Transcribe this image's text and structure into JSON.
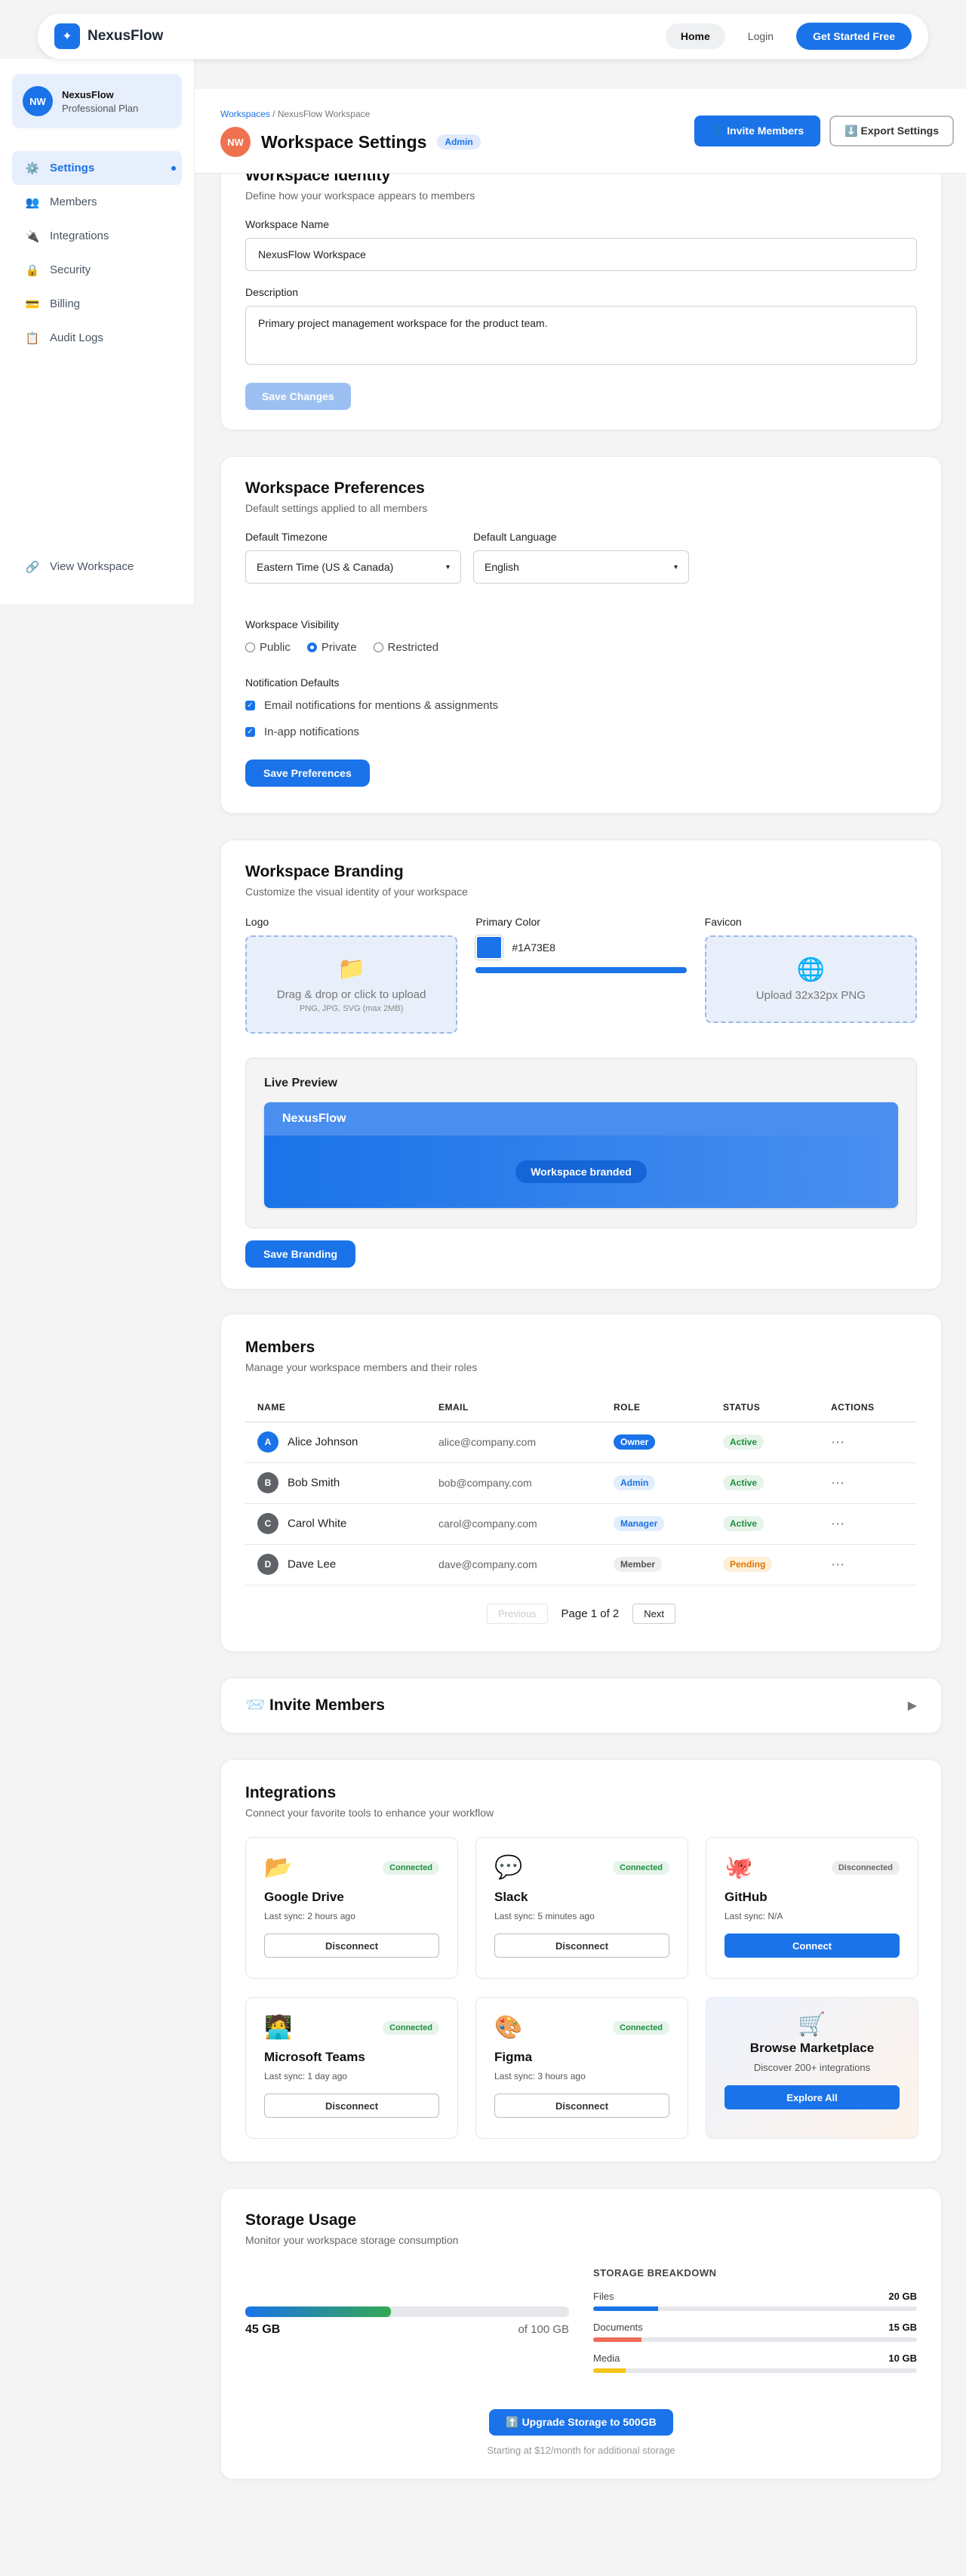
{
  "app": {
    "name": "NexusFlow",
    "logo_glyph": "✦"
  },
  "topnav": {
    "home": "Home",
    "login": "Login",
    "cta": "Get Started Free"
  },
  "sidebar": {
    "profile": {
      "initials": "NW",
      "name": "NexusFlow",
      "plan": "Professional Plan"
    },
    "items": [
      {
        "label": "Settings",
        "icon": "⚙️",
        "active": true
      },
      {
        "label": "Members",
        "icon": "👥"
      },
      {
        "label": "Integrations",
        "icon": "🔌"
      },
      {
        "label": "Security",
        "icon": "🔒"
      },
      {
        "label": "Billing",
        "icon": "💳"
      },
      {
        "label": "Audit Logs",
        "icon": "📋"
      }
    ],
    "view_workspace": {
      "label": "View Workspace",
      "icon": "🔗"
    }
  },
  "header": {
    "breadcrumb_link": "Workspaces",
    "breadcrumb_sep": " / ",
    "breadcrumb_current": "NexusFlow Workspace",
    "initials": "NW",
    "title": "Workspace Settings",
    "badge": "Admin",
    "invite_label": "👤 Invite Members",
    "export_label": "⬇️ Export Settings"
  },
  "identity": {
    "title": "Workspace Identity",
    "subtitle": "Define how your workspace appears to members",
    "name_label": "Workspace Name",
    "name_value": "NexusFlow Workspace",
    "desc_label": "Description",
    "desc_value": "Primary project management workspace for the product team.",
    "save_label": "Save Changes"
  },
  "preferences": {
    "title": "Workspace Preferences",
    "subtitle": "Default settings applied to all members",
    "timezone_label": "Default Timezone",
    "timezone_value": "Eastern Time (US & Canada)",
    "language_label": "Default Language",
    "language_value": "English",
    "visibility_label": "Workspace Visibility",
    "visibility_options": [
      "Public",
      "Private",
      "Restricted"
    ],
    "visibility_selected": "Private",
    "notif_label": "Notification Defaults",
    "notif_options": [
      "Email notifications for mentions & assignments",
      "In-app notifications"
    ],
    "save_label": "Save Preferences"
  },
  "branding": {
    "title": "Workspace Branding",
    "subtitle": "Customize the visual identity of your workspace",
    "logo_label": "Logo",
    "logo_icon": "📁",
    "logo_drop": "Drag & drop or click to upload",
    "logo_hint": "PNG, JPG, SVG (max 2MB)",
    "color_label": "Primary Color",
    "color_value": "#1A73E8",
    "favicon_label": "Favicon",
    "favicon_icon": "🌐",
    "favicon_hint": "Upload 32x32px PNG",
    "preview_label": "Live Preview",
    "preview_brand": "NexusFlow",
    "preview_pill": "Workspace branded",
    "save_label": "Save Branding"
  },
  "members": {
    "title": "Members",
    "subtitle": "Manage your workspace members and their roles",
    "columns": [
      "NAME",
      "EMAIL",
      "ROLE",
      "STATUS",
      "ACTIONS"
    ],
    "rows": [
      {
        "initial": "A",
        "name": "Alice Johnson",
        "email": "alice@company.com",
        "role": "Owner",
        "status": "Active",
        "actions": "⋯"
      },
      {
        "initial": "B",
        "name": "Bob Smith",
        "email": "bob@company.com",
        "role": "Admin",
        "status": "Active",
        "actions": "⋯"
      },
      {
        "initial": "C",
        "name": "Carol White",
        "email": "carol@company.com",
        "role": "Manager",
        "status": "Active",
        "actions": "⋯"
      },
      {
        "initial": "D",
        "name": "Dave Lee",
        "email": "dave@company.com",
        "role": "Member",
        "status": "Pending",
        "actions": "⋯"
      }
    ],
    "prev_label": "Previous",
    "page_label": "Page 1 of 2",
    "next_label": "Next"
  },
  "invite_section": {
    "title": "📨 Invite Members",
    "chevron": "▶"
  },
  "integrations": {
    "title": "Integrations",
    "subtitle": "Connect your favorite tools to enhance your workflow",
    "items": [
      {
        "icon": "📂",
        "name": "Google Drive",
        "status": "Connected",
        "sync": "Last sync: 2 hours ago",
        "action": "Disconnect"
      },
      {
        "icon": "💬",
        "name": "Slack",
        "status": "Connected",
        "sync": "Last sync: 5 minutes ago",
        "action": "Disconnect"
      },
      {
        "icon": "🐙",
        "name": "GitHub",
        "status": "Disconnected",
        "sync": "Last sync: N/A",
        "action": "Connect"
      },
      {
        "icon": "🧑‍💻",
        "name": "Microsoft Teams",
        "status": "Connected",
        "sync": "Last sync: 1 day ago",
        "action": "Disconnect"
      },
      {
        "icon": "🎨",
        "name": "Figma",
        "status": "Connected",
        "sync": "Last sync: 3 hours ago",
        "action": "Disconnect"
      }
    ],
    "marketplace": {
      "icon": "🛒",
      "title": "Browse Marketplace",
      "subtitle": "Discover 200+ integrations",
      "action": "Explore All"
    }
  },
  "storage": {
    "title": "Storage Usage",
    "subtitle": "Monitor your workspace storage consumption",
    "used": "45 GB",
    "total": "of 100 GB",
    "used_fraction": 0.45,
    "breakdown_title": "STORAGE BREAKDOWN",
    "breakdown": [
      {
        "label": "Files",
        "value": "20 GB",
        "fraction": 0.2,
        "color": "#1a73e8"
      },
      {
        "label": "Documents",
        "value": "15 GB",
        "fraction": 0.15,
        "color": "#ef6c57"
      },
      {
        "label": "Media",
        "value": "10 GB",
        "fraction": 0.1,
        "color": "#f5c518"
      }
    ],
    "upgrade_label": "⬆️ Upgrade Storage to 500GB",
    "upgrade_note": "Starting at $12/month for additional storage"
  },
  "colors": {
    "accent": "#1a73e8",
    "success": "#1e8e3e",
    "warning": "#e37400"
  }
}
